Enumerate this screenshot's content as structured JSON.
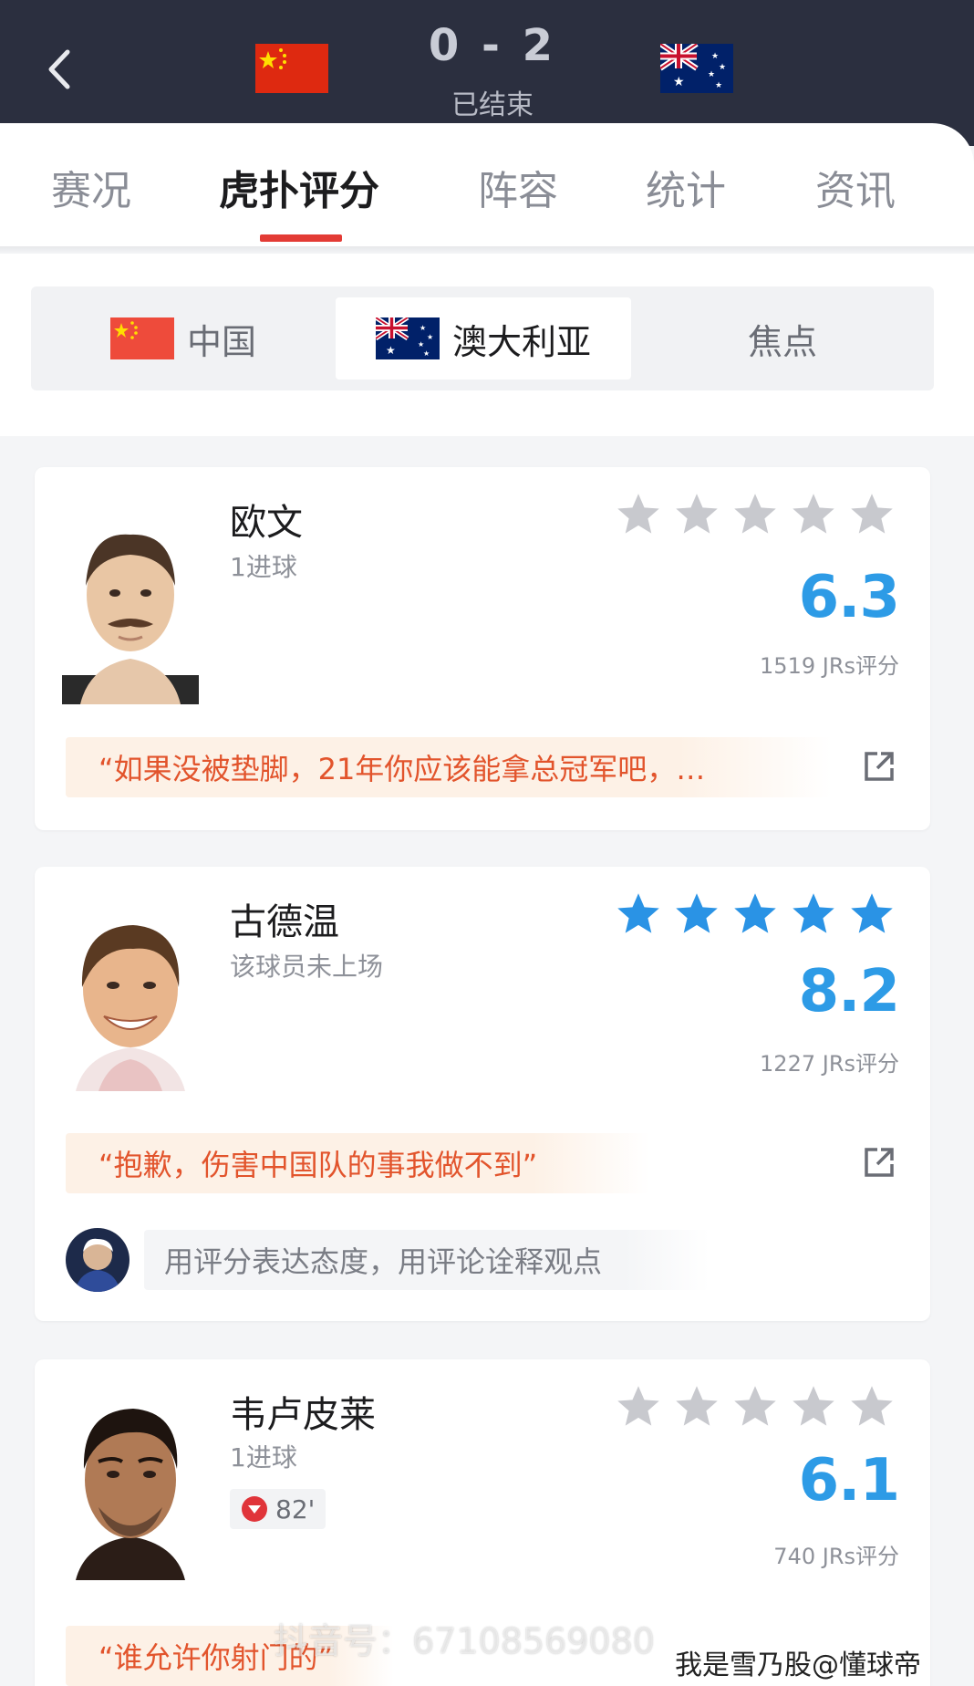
{
  "header": {
    "score": "0 - 2",
    "status": "已结束",
    "home_flag": "china-flag",
    "away_flag": "australia-flag",
    "back_icon": "chevron-left-icon"
  },
  "tabs": [
    {
      "label": "赛况",
      "active": false
    },
    {
      "label": "虎扑评分",
      "active": true
    },
    {
      "label": "阵容",
      "active": false
    },
    {
      "label": "统计",
      "active": false
    },
    {
      "label": "资讯",
      "active": false
    }
  ],
  "teams": [
    {
      "label": "中国",
      "flag": "china-flag",
      "active": false
    },
    {
      "label": "澳大利亚",
      "flag": "australia-flag",
      "active": true
    },
    {
      "label": "焦点",
      "active": false
    }
  ],
  "colors": {
    "header_bg": "#2b2f3f",
    "accent_red": "#e33b35",
    "rating_blue": "#2d9be6",
    "quote_orange": "#e2542c",
    "star_filled": "#2a93e5",
    "star_empty": "#c8c9ce"
  },
  "players": [
    {
      "name": "欧文",
      "status": "1进球",
      "stars_filled": 0,
      "rating": "6.3",
      "votes": "1519 JRs评分",
      "quote": "“如果没被垫脚，21年你应该能拿总冠军吧，…"
    },
    {
      "name": "古德温",
      "status": "该球员未上场",
      "stars_filled": 5,
      "rating": "8.2",
      "votes": "1227 JRs评分",
      "quote": "“抱歉，伤害中国队的事我做不到”",
      "comment_placeholder": "用评分表达态度，用评论诠释观点"
    },
    {
      "name": "韦卢皮莱",
      "status": "1进球",
      "sub_minute": "82'",
      "stars_filled": 0,
      "rating": "6.1",
      "votes": "740 JRs评分",
      "quote": "“谁允许你射门的”"
    }
  ],
  "overlay": {
    "watermark": "抖音号：67108569080",
    "credit": "我是雪乃股@懂球帝"
  }
}
